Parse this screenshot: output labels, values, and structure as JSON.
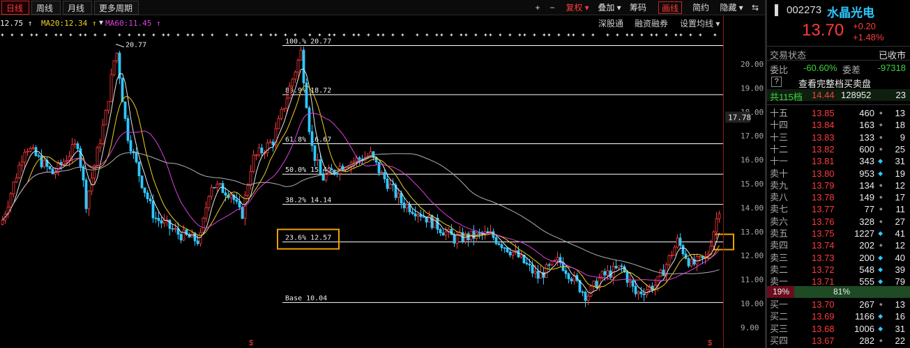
{
  "toolbar": {
    "tabs": [
      "日线",
      "周线",
      "月线",
      "更多周期 ▾"
    ],
    "right_buttons": [
      "+",
      "−",
      "复权 ▾",
      "叠加 ▾",
      "筹码",
      "画线",
      "简约",
      "隐藏 ▾",
      "⇆"
    ]
  },
  "ma_line": {
    "ma5": "12.75 ↑",
    "ma20": "MA20:12.34 ↑",
    "ma60": "MA60:11.45 ↑"
  },
  "chart_links": {
    "sh": "深股通",
    "margin": "融资融券",
    "ma_set": "设置均线 ▾"
  },
  "chart": {
    "price_axis": [
      "20.00",
      "19.00",
      "18.00",
      "17.00",
      "16.00",
      "15.00",
      "14.00",
      "13.00",
      "12.00",
      "11.00",
      "10.00",
      "9.00"
    ],
    "price_badge": "17.78",
    "high_label": "20.77",
    "marker_symbol": "$",
    "fib_levels": [
      {
        "label": "100.% 20.77",
        "value": 20.77
      },
      {
        "label": "80.9% 18.72",
        "value": 18.72
      },
      {
        "label": "61.8% 16.67",
        "value": 16.67
      },
      {
        "label": "50.0% 15.40",
        "value": 15.4
      },
      {
        "label": "38.2% 14.14",
        "value": 14.14
      },
      {
        "label": "23.6% 12.57",
        "value": 12.57
      },
      {
        "label": "Base  10.04",
        "value": 10.04
      }
    ],
    "colors": {
      "up": "#ff3b3b",
      "down": "#2ec8ff",
      "ma5": "#e8e8e8",
      "ma10": "#f0d020",
      "ma20": "#e040e0",
      "ma60": "#b0b0b0",
      "fib": "#ffffff",
      "highlight": "#f0a000"
    }
  },
  "stock": {
    "code": "002273",
    "name": "水晶光电",
    "price": "13.70",
    "change": "+0.20",
    "change_pct": "+1.48%"
  },
  "trade": {
    "status_label": "交易状态",
    "status_value": "已收市",
    "weibi_label": "委比",
    "weibi_value": "-60.60%",
    "weicha_label": "委差",
    "weicha_value": "-97318",
    "help": "?",
    "full_book": "查看完整档买卖盘",
    "total_label": "共115档",
    "total_price": "14.44",
    "total_vol": "128952",
    "total_count": "23"
  },
  "sell_orders": [
    {
      "label": "十五",
      "price": "13.85",
      "vol": "460",
      "dot": "●",
      "cnt": "13"
    },
    {
      "label": "十四",
      "price": "13.84",
      "vol": "163",
      "dot": "●",
      "cnt": "18"
    },
    {
      "label": "十三",
      "price": "13.83",
      "vol": "133",
      "dot": "●",
      "cnt": "9"
    },
    {
      "label": "十二",
      "price": "13.82",
      "vol": "600",
      "dot": "●",
      "cnt": "25"
    },
    {
      "label": "十一",
      "price": "13.81",
      "vol": "343",
      "dot": "◆",
      "cnt": "31"
    },
    {
      "label": "卖十",
      "price": "13.80",
      "vol": "953",
      "dot": "◆",
      "cnt": "19"
    },
    {
      "label": "卖九",
      "price": "13.79",
      "vol": "134",
      "dot": "●",
      "cnt": "12"
    },
    {
      "label": "卖八",
      "price": "13.78",
      "vol": "149",
      "dot": "●",
      "cnt": "17"
    },
    {
      "label": "卖七",
      "price": "13.77",
      "vol": "77",
      "dot": "●",
      "cnt": "11"
    },
    {
      "label": "卖六",
      "price": "13.76",
      "vol": "328",
      "dot": "●",
      "cnt": "27"
    },
    {
      "label": "卖五",
      "price": "13.75",
      "vol": "1227",
      "dot": "◆",
      "cnt": "41"
    },
    {
      "label": "卖四",
      "price": "13.74",
      "vol": "202",
      "dot": "●",
      "cnt": "12"
    },
    {
      "label": "卖三",
      "price": "13.73",
      "vol": "200",
      "dot": "◆",
      "cnt": "40"
    },
    {
      "label": "卖二",
      "price": "13.72",
      "vol": "548",
      "dot": "◆",
      "cnt": "39"
    },
    {
      "label": "卖一",
      "price": "13.71",
      "vol": "555",
      "dot": "◆",
      "cnt": "79"
    }
  ],
  "ratio": {
    "sell_pct": "19%",
    "buy_pct": "81%",
    "sell": 19,
    "buy": 81
  },
  "buy_orders": [
    {
      "label": "买一",
      "price": "13.70",
      "vol": "267",
      "dot": "●",
      "cnt": "13"
    },
    {
      "label": "买二",
      "price": "13.69",
      "vol": "1166",
      "dot": "◆",
      "cnt": "16"
    },
    {
      "label": "买三",
      "price": "13.68",
      "vol": "1006",
      "dot": "◆",
      "cnt": "31"
    },
    {
      "label": "买四",
      "price": "13.67",
      "vol": "282",
      "dot": "●",
      "cnt": "22"
    }
  ]
}
